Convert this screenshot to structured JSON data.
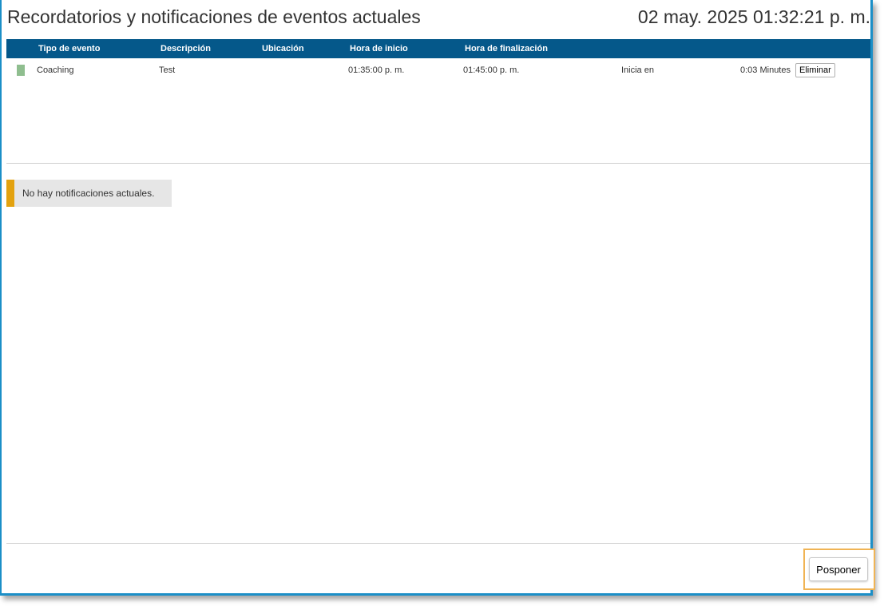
{
  "header": {
    "title": "Recordatorios y notificaciones de eventos actuales",
    "datetime": "02 may. 2025 01:32:21 p. m."
  },
  "events_table": {
    "columns": [
      "Tipo de evento",
      "Descripción",
      "Ubicación",
      "Hora de inicio",
      "Hora de finalización"
    ],
    "rows": [
      {
        "color": "#8fbe8f",
        "type": "Coaching",
        "description": "Test",
        "location": "",
        "start": "01:35:00 p. m.",
        "end": "01:45:00 p. m.",
        "starts_in_label": "Inicia en",
        "starts_in_value": "0:03 Minutes",
        "delete_label": "Eliminar"
      }
    ]
  },
  "notifications": {
    "empty_message": "No hay notificaciones actuales.",
    "accent_color": "#e3a20f"
  },
  "footer": {
    "snooze_label": "Posponer"
  },
  "colors": {
    "header_bg": "#05588a",
    "window_border": "#1b8fc7"
  }
}
